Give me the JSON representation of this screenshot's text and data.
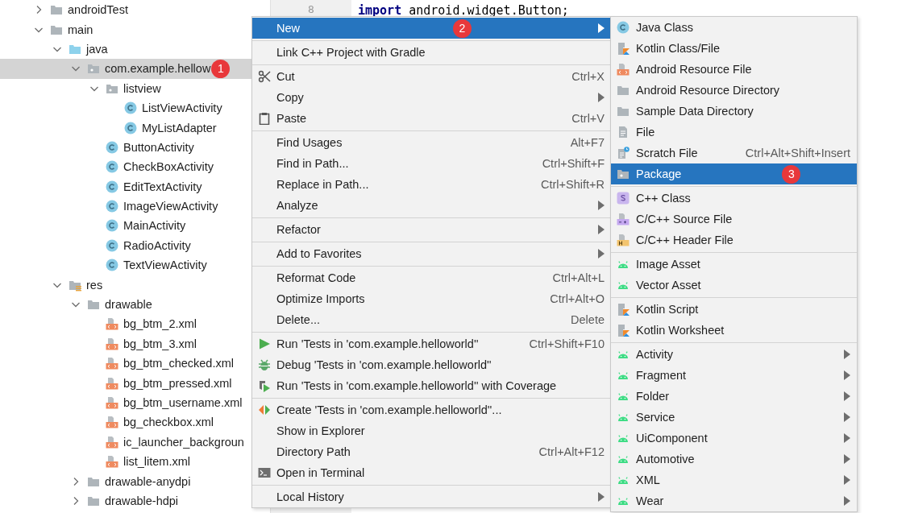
{
  "tree": [
    {
      "label": "androidTest",
      "kind": "folder",
      "expanded": false,
      "selected": false
    },
    {
      "label": "main",
      "kind": "folder",
      "expanded": true,
      "selected": false,
      "children": [
        {
          "label": "java",
          "kind": "source-folder",
          "expanded": true,
          "selected": false,
          "children": [
            {
              "label": "com.example.hellow",
              "kind": "package",
              "expanded": true,
              "selected": true,
              "badge": "1",
              "children": [
                {
                  "label": "listview",
                  "kind": "package",
                  "expanded": true,
                  "selected": false,
                  "children": [
                    {
                      "label": "ListViewActivity",
                      "kind": "class",
                      "selected": false
                    },
                    {
                      "label": "MyListAdapter",
                      "kind": "class",
                      "selected": false
                    }
                  ]
                },
                {
                  "label": "ButtonActivity",
                  "kind": "class",
                  "selected": false
                },
                {
                  "label": "CheckBoxActivity",
                  "kind": "class",
                  "selected": false
                },
                {
                  "label": "EditTextActivity",
                  "kind": "class",
                  "selected": false
                },
                {
                  "label": "ImageViewActivity",
                  "kind": "class",
                  "selected": false
                },
                {
                  "label": "MainActivity",
                  "kind": "class",
                  "selected": false
                },
                {
                  "label": "RadioActivity",
                  "kind": "class",
                  "selected": false
                },
                {
                  "label": "TextViewActivity",
                  "kind": "class",
                  "selected": false
                }
              ]
            }
          ]
        },
        {
          "label": "res",
          "kind": "res-folder",
          "expanded": true,
          "selected": false,
          "children": [
            {
              "label": "drawable",
              "kind": "folder",
              "expanded": true,
              "selected": false,
              "children": [
                {
                  "label": "bg_btm_2.xml",
                  "kind": "xml",
                  "selected": false
                },
                {
                  "label": "bg_btm_3.xml",
                  "kind": "xml",
                  "selected": false
                },
                {
                  "label": "bg_btm_checked.xml",
                  "kind": "xml",
                  "selected": false
                },
                {
                  "label": "bg_btm_pressed.xml",
                  "kind": "xml",
                  "selected": false
                },
                {
                  "label": "bg_btm_username.xml",
                  "kind": "xml",
                  "selected": false
                },
                {
                  "label": "bg_checkbox.xml",
                  "kind": "xml",
                  "selected": false
                },
                {
                  "label": "ic_launcher_backgroun",
                  "kind": "xml",
                  "selected": false
                },
                {
                  "label": "list_litem.xml",
                  "kind": "xml",
                  "selected": false
                }
              ]
            },
            {
              "label": "drawable-anydpi",
              "kind": "folder",
              "expanded": false,
              "selected": false
            },
            {
              "label": "drawable-hdpi",
              "kind": "folder",
              "expanded": false,
              "selected": false
            }
          ]
        }
      ]
    }
  ],
  "editor": {
    "lines": [
      {
        "number": "8",
        "keyword": "import",
        "code": "android.widget.Button;"
      }
    ]
  },
  "context_menu": {
    "groups": [
      [
        {
          "label": "New",
          "has_submenu": true,
          "selected": true,
          "badge": "2"
        }
      ],
      [
        {
          "label": "Link C++ Project with Gradle",
          "has_submenu": false,
          "selected": false
        }
      ],
      [
        {
          "label": "Cut",
          "kind": "scissors",
          "shortcut": "Ctrl+X",
          "has_submenu": false,
          "selected": false
        },
        {
          "label": "Copy",
          "has_submenu": true,
          "selected": false
        },
        {
          "label": "Paste",
          "kind": "clipboard",
          "shortcut": "Ctrl+V",
          "has_submenu": false,
          "selected": false
        }
      ],
      [
        {
          "label": "Find Usages",
          "shortcut": "Alt+F7",
          "has_submenu": false,
          "selected": false
        },
        {
          "label": "Find in Path...",
          "shortcut": "Ctrl+Shift+F",
          "has_submenu": false,
          "selected": false
        },
        {
          "label": "Replace in Path...",
          "shortcut": "Ctrl+Shift+R",
          "has_submenu": false,
          "selected": false
        },
        {
          "label": "Analyze",
          "has_submenu": true,
          "selected": false
        }
      ],
      [
        {
          "label": "Refactor",
          "has_submenu": true,
          "selected": false
        }
      ],
      [
        {
          "label": "Add to Favorites",
          "has_submenu": true,
          "selected": false
        }
      ],
      [
        {
          "label": "Reformat Code",
          "shortcut": "Ctrl+Alt+L",
          "has_submenu": false,
          "selected": false
        },
        {
          "label": "Optimize Imports",
          "shortcut": "Ctrl+Alt+O",
          "has_submenu": false,
          "selected": false
        },
        {
          "label": "Delete...",
          "shortcut": "Delete",
          "has_submenu": false,
          "selected": false
        }
      ],
      [
        {
          "label": "Run 'Tests in 'com.example.helloworld''",
          "kind": "run",
          "shortcut": "Ctrl+Shift+F10",
          "has_submenu": false,
          "selected": false
        },
        {
          "label": "Debug 'Tests in 'com.example.helloworld''",
          "kind": "bug",
          "has_submenu": false,
          "selected": false
        },
        {
          "label": "Run 'Tests in 'com.example.helloworld'' with Coverage",
          "kind": "coverage",
          "has_submenu": false,
          "selected": false
        }
      ],
      [
        {
          "label": "Create 'Tests in 'com.example.helloworld''...",
          "kind": "create",
          "has_submenu": false,
          "selected": false
        },
        {
          "label": "Show in Explorer",
          "has_submenu": false,
          "selected": false
        },
        {
          "label": "Directory Path",
          "shortcut": "Ctrl+Alt+F12",
          "has_submenu": false,
          "selected": false
        },
        {
          "label": "Open in Terminal",
          "kind": "terminal",
          "has_submenu": false,
          "selected": false
        }
      ],
      [
        {
          "label": "Local History",
          "has_submenu": true,
          "selected": false
        }
      ]
    ]
  },
  "submenu": {
    "groups": [
      [
        {
          "label": "Java Class",
          "kind": "class",
          "has_submenu": false,
          "selected": false
        },
        {
          "label": "Kotlin Class/File",
          "kind": "kotlin",
          "has_submenu": false,
          "selected": false
        },
        {
          "label": "Android Resource File",
          "kind": "xml",
          "has_submenu": false,
          "selected": false
        },
        {
          "label": "Android Resource Directory",
          "kind": "folder",
          "has_submenu": false,
          "selected": false
        },
        {
          "label": "Sample Data Directory",
          "kind": "folder",
          "has_submenu": false,
          "selected": false
        },
        {
          "label": "File",
          "kind": "file",
          "has_submenu": false,
          "selected": false
        },
        {
          "label": "Scratch File",
          "kind": "scratch",
          "shortcut": "Ctrl+Alt+Shift+Insert",
          "has_submenu": false,
          "selected": false
        },
        {
          "label": "Package",
          "kind": "package",
          "has_submenu": false,
          "selected": true,
          "badge": "3"
        }
      ],
      [
        {
          "label": "C++ Class",
          "kind": "cpp-class",
          "has_submenu": false,
          "selected": false
        },
        {
          "label": "C/C++ Source File",
          "kind": "cpp-source",
          "has_submenu": false,
          "selected": false
        },
        {
          "label": "C/C++ Header File",
          "kind": "cpp-header",
          "has_submenu": false,
          "selected": false
        }
      ],
      [
        {
          "label": "Image Asset",
          "kind": "android",
          "has_submenu": false,
          "selected": false
        },
        {
          "label": "Vector Asset",
          "kind": "android",
          "has_submenu": false,
          "selected": false
        }
      ],
      [
        {
          "label": "Kotlin Script",
          "kind": "kotlin",
          "has_submenu": false,
          "selected": false
        },
        {
          "label": "Kotlin Worksheet",
          "kind": "kotlin",
          "has_submenu": false,
          "selected": false
        }
      ],
      [
        {
          "label": "Activity",
          "kind": "android",
          "has_submenu": true,
          "selected": false
        },
        {
          "label": "Fragment",
          "kind": "android",
          "has_submenu": true,
          "selected": false
        },
        {
          "label": "Folder",
          "kind": "android",
          "has_submenu": true,
          "selected": false
        },
        {
          "label": "Service",
          "kind": "android",
          "has_submenu": true,
          "selected": false
        },
        {
          "label": "UiComponent",
          "kind": "android",
          "has_submenu": true,
          "selected": false
        },
        {
          "label": "Automotive",
          "kind": "android",
          "has_submenu": true,
          "selected": false
        },
        {
          "label": "XML",
          "kind": "android",
          "has_submenu": true,
          "selected": false
        },
        {
          "label": "Wear",
          "kind": "android",
          "has_submenu": true,
          "selected": false
        }
      ]
    ]
  }
}
